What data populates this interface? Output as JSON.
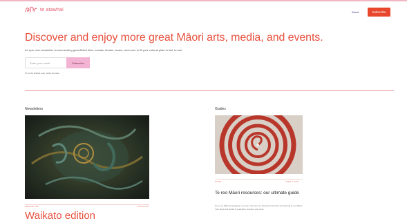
{
  "header": {
    "logo_text": "te atawhai",
    "logo_icon": "maori-motif-icon",
    "about_label": "About",
    "subscribe_label": "Subscribe"
  },
  "hero": {
    "title": "Discover and enjoy more great Māori arts, media, and events.",
    "subtitle": "An epic new newsletter recommending great Māori films, socials, theatre, books, and more to fill your cultural plate to kiki, to ruki.",
    "email_placeholder": "Enter your email",
    "submit_label": "Subscribe",
    "privacy_note": "I'll not be shared, ever, pinky promise."
  },
  "sections": {
    "newsletters": {
      "label": "Newsletters",
      "card": {
        "meta_left": "NEWSLETTER",
        "meta_right": "5 DAYS AGO",
        "title": "Waikato edition"
      }
    },
    "guides": {
      "label": "Guides",
      "card": {
        "meta_left": "GUIDE",
        "meta_right": "APRIL 8, 2024",
        "title": "Te reo Māori resources: our ultimate guide",
        "excerpt": "Ko te reo Māori te kaupapa o te kete. Here are our favourite resources for learning te reo Māori, from apps and books to podcasts, courses, and more."
      }
    }
  },
  "colors": {
    "accent": "#e8503d",
    "button": "#e8472c",
    "submit": "#f3b3d2",
    "divider": "#e89a9a"
  }
}
